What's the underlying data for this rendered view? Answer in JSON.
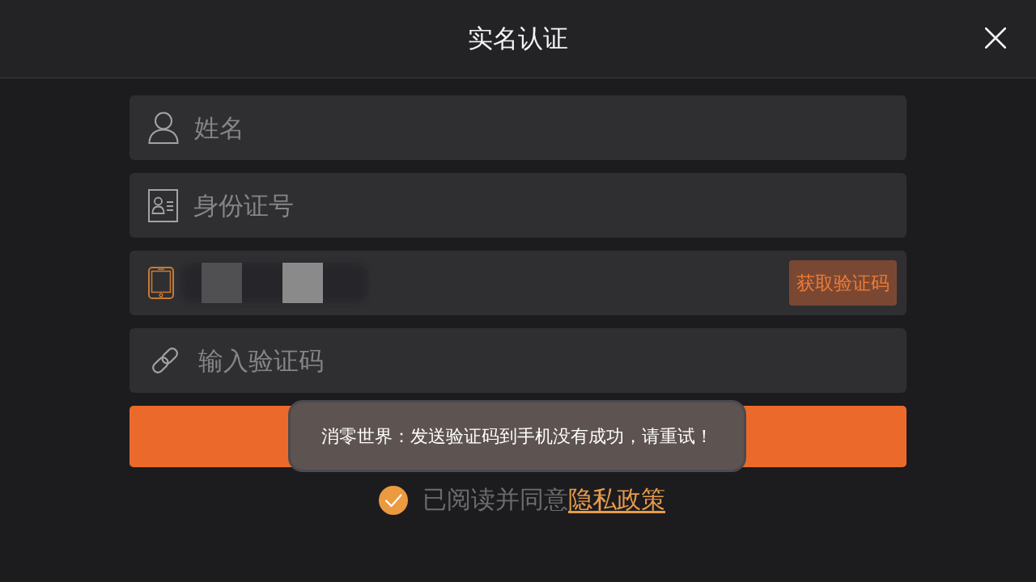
{
  "header": {
    "title": "实名认证"
  },
  "fields": [
    {
      "kind": "name",
      "placeholder": "姓名",
      "active": false,
      "redacted": false
    },
    {
      "kind": "id_number",
      "placeholder": "身份证号",
      "active": false,
      "redacted": false
    },
    {
      "kind": "phone",
      "active": true,
      "redacted": true,
      "action": "获取验证码"
    },
    {
      "kind": "code",
      "placeholder": "输入验证码",
      "active": false,
      "redacted": false
    }
  ],
  "toast": {
    "text": "消零世界：发送验证码到手机没有成功，请重试！"
  },
  "agreement": {
    "checked": true,
    "text": "已阅读并同意",
    "link": "隐私政策"
  }
}
